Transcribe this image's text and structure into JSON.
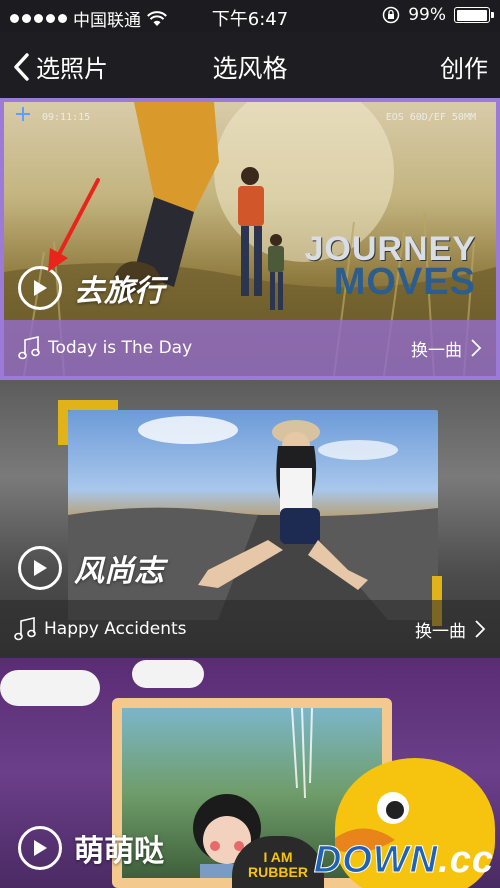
{
  "status_bar": {
    "carrier": "中国联通",
    "time": "下午6:47",
    "battery_percent": "99%",
    "battery_level": 0.99
  },
  "nav": {
    "back_label": "选照片",
    "title": "选风格",
    "action_label": "创作"
  },
  "styles": [
    {
      "name": "去旅行",
      "song": "Today is The Day",
      "change_label": "换一曲",
      "selected": true,
      "hud_left": "09:11:15",
      "hud_right": "EOS 60D/EF 50MM",
      "overlay_line1": "JOURNEY",
      "overlay_line2": "MOVES"
    },
    {
      "name": "风尚志",
      "song": "Happy Accidents",
      "change_label": "换一曲",
      "selected": false
    },
    {
      "name": "萌萌哒",
      "selected": false,
      "sign_text": "I AM RUBBER"
    }
  ],
  "watermark": {
    "part1": "DOWN",
    "part2": ".cc"
  },
  "colors": {
    "selected_border": "#9b7ad8",
    "selected_music_bar": "#926cc8",
    "annotation_arrow": "#e8241b",
    "corner_accent": "#e0b419"
  }
}
